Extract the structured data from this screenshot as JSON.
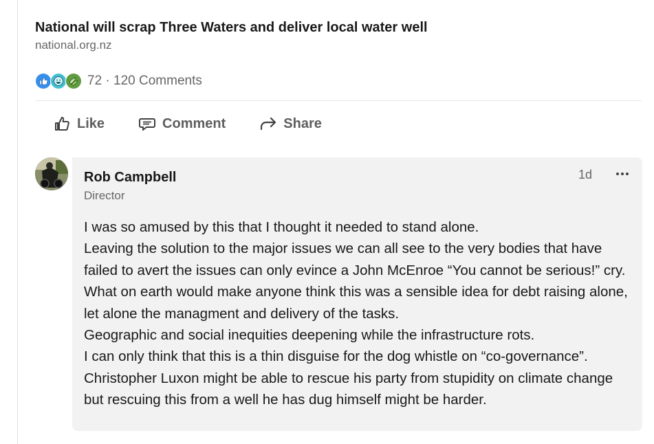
{
  "article": {
    "title": "National will scrap Three Waters and deliver local water well",
    "source": "national.org.nz"
  },
  "social": {
    "reactions": [
      "like-reaction-icon",
      "funny-reaction-icon",
      "support-reaction-icon"
    ],
    "counts": "72 · 120 Comments"
  },
  "actions": {
    "like_label": "Like",
    "comment_label": "Comment",
    "share_label": "Share"
  },
  "comment": {
    "author": "Rob Campbell",
    "headline": "Director",
    "time": "1d",
    "lines": [
      "I was so amused by this that I thought it needed to stand alone.",
      "Leaving the solution to the major issues we can all see to the very bodies that have failed to avert the issues can only evince a John McEnroe “You cannot be serious!” cry.",
      "What on earth would make anyone think this was a sensible idea for debt raising alone, let alone the managment and delivery of the tasks.",
      "Geographic and social inequities deepening while the infrastructure rots.",
      "I can only think that this is a thin disguise for the dog whistle on “co-governance”.",
      "Christopher Luxon might be able to rescue his party from stupidity on climate change but rescuing this from a well he has dug himself might be harder."
    ]
  },
  "colors": {
    "like_blue": "#378fe9",
    "funny_teal": "#44bfd3",
    "support_green": "#5f9b41",
    "comment_bg": "#f2f2f2",
    "muted_text": "#666666"
  }
}
